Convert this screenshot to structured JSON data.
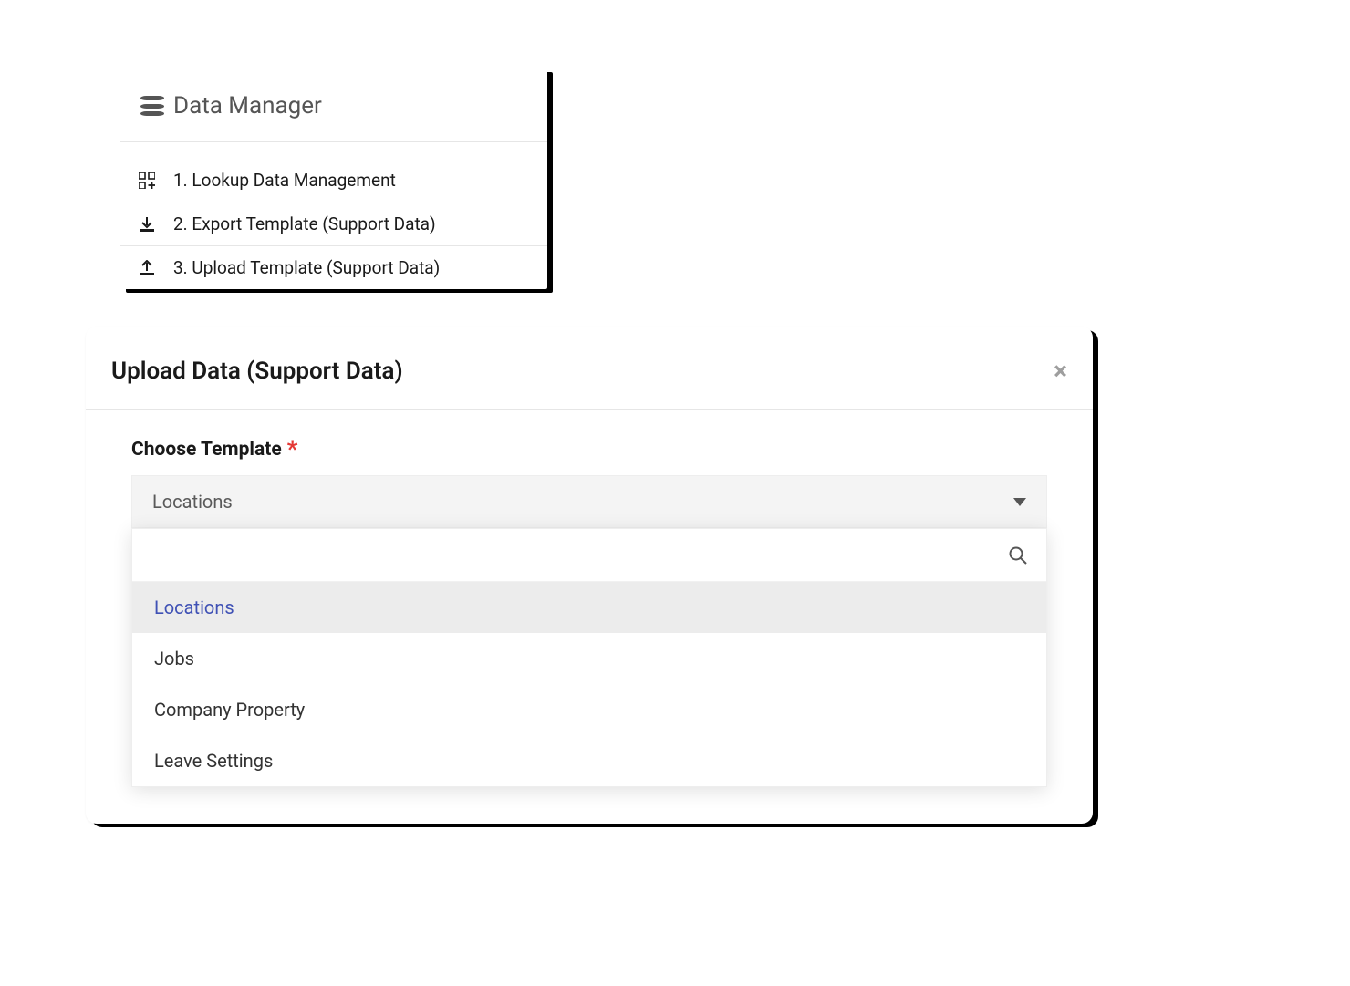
{
  "dataManager": {
    "title": "Data Manager",
    "items": [
      {
        "label": "1. Lookup Data Management"
      },
      {
        "label": "2. Export Template (Support Data)"
      },
      {
        "label": "3. Upload Template (Support Data)"
      }
    ]
  },
  "dialog": {
    "title": "Upload Data (Support Data)",
    "close_glyph": "×",
    "field_label": "Choose Template",
    "required_mark": "*",
    "selected_value": "Locations",
    "search_placeholder": "",
    "options": [
      "Locations",
      "Jobs",
      "Company Property",
      "Leave Settings"
    ]
  }
}
